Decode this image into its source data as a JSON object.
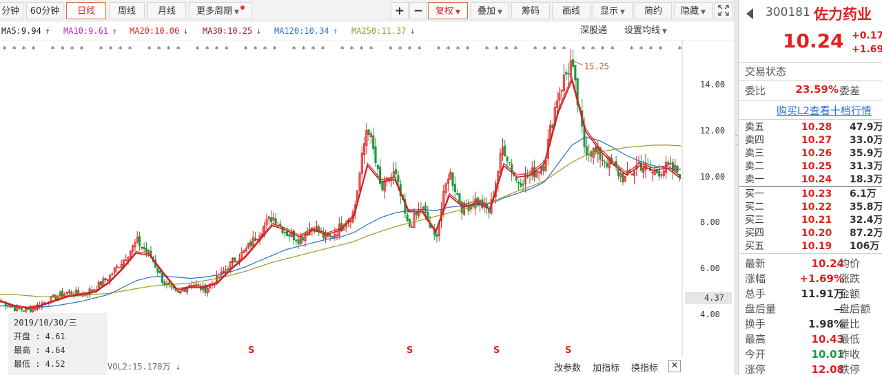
{
  "toolbar": {
    "left_tabs": [
      "分钟",
      "60分钟",
      "日线",
      "周线",
      "月线",
      "更多周期"
    ],
    "active_tab": "日线",
    "right_buttons": [
      "+",
      "−",
      "复权",
      "叠加",
      "筹码",
      "画线",
      "显示",
      "简约",
      "隐藏"
    ]
  },
  "ma_legend": [
    {
      "label": "MA5:9.94",
      "arrow": "↑",
      "color": "#1a1a1a"
    },
    {
      "label": "MA10:9.61",
      "arrow": "↑",
      "color": "#c020c0"
    },
    {
      "label": "MA20:10.00",
      "arrow": "↓",
      "color": "#e02020"
    },
    {
      "label": "MA30:10.25",
      "arrow": "↓",
      "color": "#8b1a1a"
    },
    {
      "label": "MA120:10.34",
      "arrow": "↑",
      "color": "#2a70c0"
    },
    {
      "label": "MA250:11.37",
      "arrow": "↓",
      "color": "#9a9a20"
    }
  ],
  "ma_right": {
    "deep": "深股通",
    "settings": "设置均线"
  },
  "colors": {
    "up": "#e02020",
    "down": "#1a9a40",
    "ma5": "#c02020",
    "ma10": "#c020c0",
    "ma20": "#e02020",
    "ma120": "#2a70c0",
    "ma250": "#9a9a20"
  },
  "chart_data": {
    "type": "candlestick",
    "y_ticks": [
      "14.00",
      "12.00",
      "10.00",
      "8.00",
      "6.00",
      "4.00"
    ],
    "ylim": [
      3.7,
      15.2
    ],
    "annotation": "15.25",
    "current_price_label": "4.37",
    "close_path": [
      4.6,
      4.3,
      4.2,
      4.5,
      4.8,
      5.0,
      4.9,
      5.2,
      5.7,
      6.4,
      7.2,
      6.6,
      5.4,
      4.9,
      5.4,
      5.1,
      5.6,
      6.3,
      6.8,
      7.6,
      8.3,
      7.6,
      7.3,
      7.9,
      7.3,
      7.8,
      8.5,
      12.4,
      9.4,
      10.2,
      7.8,
      8.7,
      7.3,
      10.3,
      8.6,
      9.0,
      8.5,
      11.4,
      9.8,
      10.1,
      10.6,
      13.6,
      15.0,
      11.3,
      11.0,
      10.5,
      9.9,
      10.6,
      10.2,
      10.4,
      10.24
    ],
    "ma5": [
      4.6,
      4.4,
      4.3,
      4.4,
      4.6,
      4.8,
      4.9,
      5.0,
      5.4,
      6.0,
      6.7,
      6.6,
      5.8,
      5.1,
      5.2,
      5.2,
      5.4,
      6.0,
      6.5,
      7.2,
      7.9,
      7.7,
      7.4,
      7.7,
      7.5,
      7.7,
      8.3,
      10.5,
      9.8,
      9.9,
      8.5,
      8.5,
      7.6,
      9.2,
      8.7,
      8.9,
      8.6,
      10.5,
      10.0,
      10.1,
      10.6,
      12.8,
      14.2,
      12.0,
      11.2,
      10.6,
      10.1,
      10.5,
      10.3,
      10.4,
      9.94
    ],
    "ma120": [
      4.4,
      4.4,
      4.3,
      4.35,
      4.4,
      4.5,
      4.6,
      4.75,
      4.9,
      5.2,
      5.5,
      5.65,
      5.7,
      5.65,
      5.6,
      5.65,
      5.75,
      5.9,
      6.1,
      6.35,
      6.6,
      6.85,
      7.0,
      7.15,
      7.3,
      7.4,
      7.6,
      7.95,
      8.25,
      8.45,
      8.55,
      8.6,
      8.55,
      8.7,
      8.75,
      8.8,
      8.85,
      9.1,
      9.3,
      9.5,
      9.8,
      10.6,
      11.4,
      11.75,
      11.6,
      11.3,
      10.95,
      10.7,
      10.5,
      10.4,
      10.34
    ],
    "ma250": [
      4.9,
      4.9,
      4.85,
      4.8,
      4.8,
      4.8,
      4.85,
      4.9,
      4.95,
      5.05,
      5.15,
      5.25,
      5.3,
      5.35,
      5.4,
      5.5,
      5.6,
      5.75,
      5.9,
      6.1,
      6.3,
      6.45,
      6.6,
      6.75,
      6.9,
      7.05,
      7.2,
      7.45,
      7.65,
      7.85,
      8.0,
      8.15,
      8.3,
      8.45,
      8.6,
      8.75,
      8.9,
      9.15,
      9.4,
      9.6,
      9.85,
      10.25,
      10.65,
      10.95,
      11.1,
      11.2,
      11.3,
      11.35,
      11.4,
      11.4,
      11.37
    ],
    "s_marks": [
      "S",
      "S",
      "S",
      "S"
    ]
  },
  "infobox": {
    "date": "2019/10/30/三",
    "rows": [
      "开盘 : 4.61",
      "最高 : 4.64",
      "最低 : 4.52"
    ]
  },
  "bottom": {
    "vol": "VOL2:15.170万",
    "vol_arrow": "↓",
    "buttons": [
      "改参数",
      "加指标",
      "换指标"
    ],
    "close": "✕"
  },
  "panel": {
    "code": "300181",
    "name": "佐力药业",
    "price": "10.24",
    "change": "+0.17",
    "change_pct": "+1.69",
    "trade_status": "交易状态",
    "weibi_label": "委比",
    "weibi": "23.59%",
    "weicha_label": "委差",
    "l2_link": "购买L2查看十档行情",
    "asks": [
      {
        "label": "卖五",
        "price": "10.28",
        "vol": "47.9万"
      },
      {
        "label": "卖四",
        "price": "10.27",
        "vol": "33.0万"
      },
      {
        "label": "卖三",
        "price": "10.26",
        "vol": "35.9万"
      },
      {
        "label": "卖二",
        "price": "10.25",
        "vol": "31.3万"
      },
      {
        "label": "卖一",
        "price": "10.24",
        "vol": "18.3万"
      }
    ],
    "bids": [
      {
        "label": "买一",
        "price": "10.23",
        "vol": "6.1万"
      },
      {
        "label": "买二",
        "price": "10.22",
        "vol": "35.8万"
      },
      {
        "label": "买三",
        "price": "10.21",
        "vol": "32.4万"
      },
      {
        "label": "买四",
        "price": "10.20",
        "vol": "87.2万"
      },
      {
        "label": "买五",
        "price": "10.19",
        "vol": "106万"
      }
    ],
    "stats": [
      {
        "l": "最新",
        "v": "10.24",
        "c": "#e02020",
        "r": "均价"
      },
      {
        "l": "涨幅",
        "v": "+1.69%",
        "c": "#e02020",
        "r": "涨跌"
      },
      {
        "l": "总手",
        "v": "11.91万",
        "c": "#333333",
        "r": "金额"
      },
      {
        "l": "盘后量",
        "v": "—",
        "c": "#333333",
        "r": "盘后额"
      },
      {
        "l": "换手",
        "v": "1.98%",
        "c": "#333333",
        "r": "量比"
      },
      {
        "l": "最高",
        "v": "10.43",
        "c": "#e02020",
        "r": "最低"
      },
      {
        "l": "今开",
        "v": "10.01",
        "c": "#1a9a40",
        "r": "昨收"
      },
      {
        "l": "涨停",
        "v": "12.08",
        "c": "#e02020",
        "r": "跌停"
      }
    ]
  }
}
